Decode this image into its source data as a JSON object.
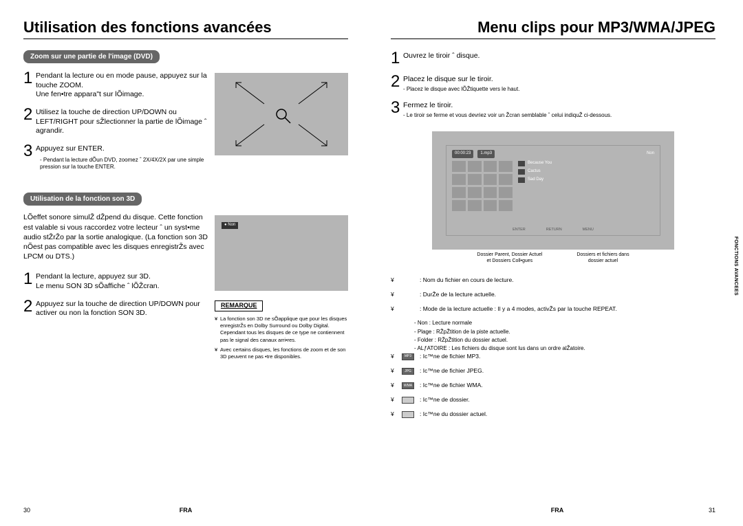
{
  "left": {
    "title": "Utilisation des fonctions avancées",
    "sec1": {
      "pill": "Zoom sur une partie de l'image (DVD)",
      "s1a": "Pendant la lecture ou en mode pause, appuyez sur la touche ZOOM.",
      "s1b": "Une fen•tre appara\"t sur lÕimage.",
      "s2": "Utilisez la touche de direction UP/DOWN ou LEFT/RIGHT pour sŽlectionner la partie de lÕimage ˆ agrandir.",
      "s3": "Appuyez sur ENTER.",
      "s3note": "- Pendant la lecture dÕun DVD, zoomez ˆ 2X/4X/2X par une simple pression sur la touche ENTER."
    },
    "sec2": {
      "pill": "Utilisation de la fonction son 3D",
      "intro": "LÕeffet sonore simulŽ dŽpend du disque. Cette fonction est valable si vous raccordez votre lecteur ˆ un syst•me audio stŽrŽo par la sortie analogique. (La fonction son 3D nÕest pas compatible avec les disques enregistrŽs avec LPCM ou DTS.)",
      "s1a": "Pendant la lecture, appuyez sur 3D.",
      "s1b": "Le menu SON 3D sÕaffiche ˆ lÕŽcran.",
      "s2": "Appuyez sur la touche de direction UP/DOWN pour activer ou non la fonction SON 3D.",
      "nonbadge": "Non",
      "remarque_label": "REMARQUE",
      "r1": "La fonction son 3D ne sÕapplique que pour les disques enregistrŽs en Dolby Surround ou Dolby Digital. Cependant tous les disques de ce type ne contiennent pas le signal des canaux arri•res.",
      "r2": "Avec certains disques, les fonctions de zoom et de son 3D peuvent ne pas •tre disponibles."
    },
    "pagenum": "30",
    "fra": "FRA"
  },
  "right": {
    "title": "Menu clips pour MP3/WMA/JPEG",
    "s1": "Ouvrez le tiroir ˆ disque.",
    "s2": "Placez le disque sur le tiroir.",
    "s2sub": "- Placez le disque avec lÕŽtiquette vers le haut.",
    "s3": "Fermez le tiroir.",
    "s3sub": "- Le tiroir se ferme et vous devriez voir un Žcran semblable ˆ celui indiquŽ ci-dessous.",
    "ui": {
      "time": "00:00:23",
      "file": "1.mp3",
      "mode": "Non",
      "t1": "Because You",
      "t2": "Cactus",
      "t3": "Sad Day",
      "btn1": "ENTER",
      "btn2": "RETURN",
      "btn3": "MENU"
    },
    "cap1a": "Dossier Parent, Dossier Actuel",
    "cap1b": "et Dossiers Coll•gues",
    "cap2a": "Dossiers et fichiers dans",
    "cap2b": "dossier actuel",
    "leg": {
      "a": ": Nom du fichier en cours de lecture.",
      "b": ": DurŽe de la lecture actuelle.",
      "c": ": Mode de la lecture actuelle : Il y a 4 modes, activŽs par la touche REPEAT.",
      "c1": "- Non : Lecture normale",
      "c2": "- Plage : RŽpŽtition de la piste actuelle.",
      "c3": "- Folder : RŽpŽtition du dossier actuel.",
      "c4": "- ALƒATOIRE : Les fichiers du disque sont lus dans un ordre alŽatoire.",
      "d": ": Ic™ne de fichier MP3.",
      "e": ": Ic™ne de fichier JPEG.",
      "f": ": Ic™ne de fichier WMA.",
      "g": ": Ic™ne de dossier.",
      "h": ": Ic™ne du dossier actuel.",
      "mp3": "MP3",
      "jpg": "JPG",
      "wma": "WMA"
    },
    "sidetab": "FONCTIONS AVANCEES",
    "pagenum": "31",
    "fra": "FRA"
  }
}
